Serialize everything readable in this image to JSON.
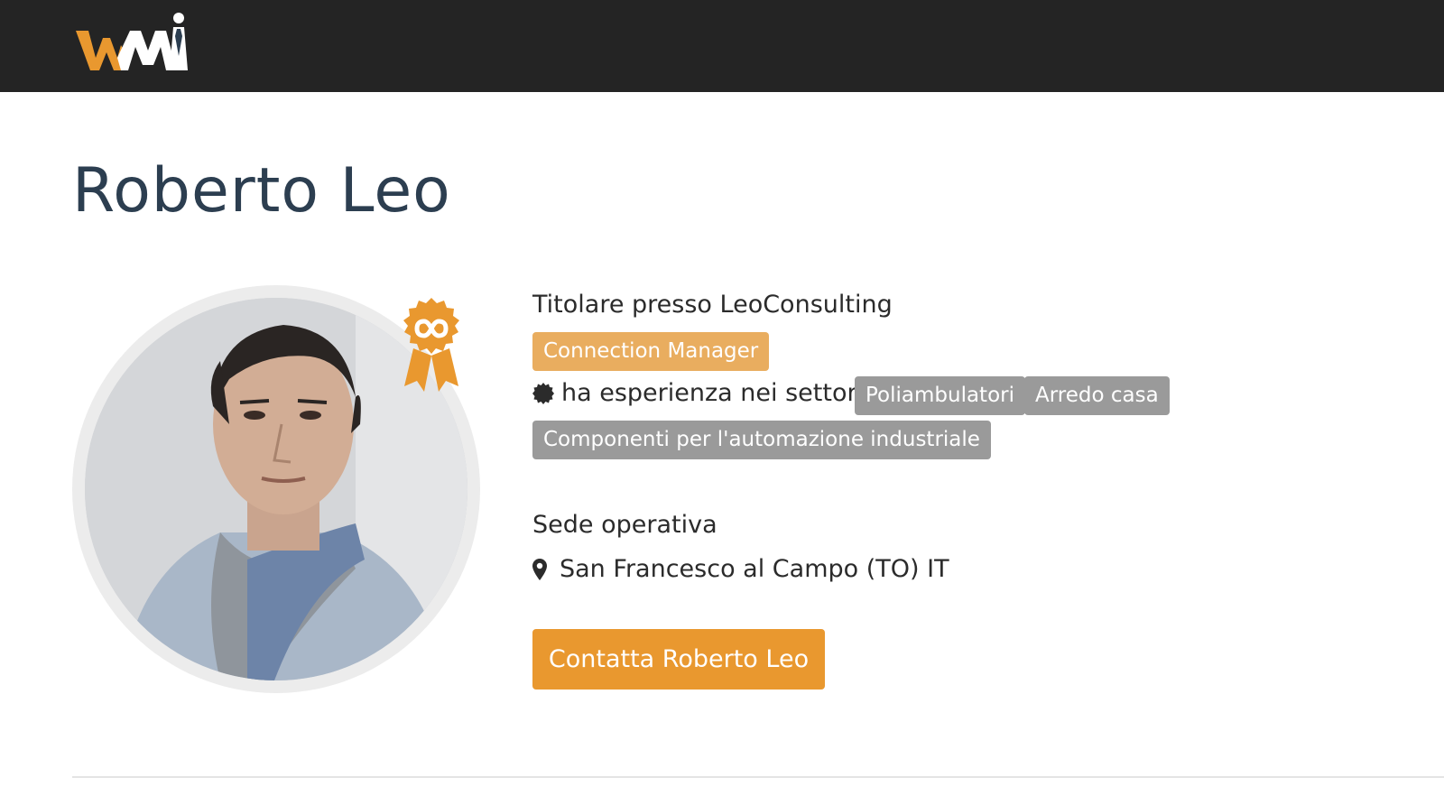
{
  "header": {
    "logo_alt": "WMI",
    "logo_icon": "wmi-logo",
    "background": "#242424"
  },
  "profile": {
    "name": "Roberto Leo",
    "photo_icon": "profile-photo",
    "badge_icon": "connection-manager-ribbon-badge",
    "job_title": "Titolare presso LeoConsulting",
    "role_tag": "Connection Manager",
    "experience_label": "ha esperienza nei settori:",
    "sectors": [
      "Poliambulatori",
      "Arredo casa",
      "Componenti per l'automazione industriale"
    ],
    "location_heading": "Sede operativa",
    "location": "San Francesco al Campo (TO) IT",
    "contact_button": "Contatta Roberto Leo"
  },
  "colors": {
    "accent_orange": "#e9982f",
    "tag_orange": "#e9ad5f",
    "tag_gray": "#9a9a9a",
    "title_color": "#2c3e50"
  }
}
